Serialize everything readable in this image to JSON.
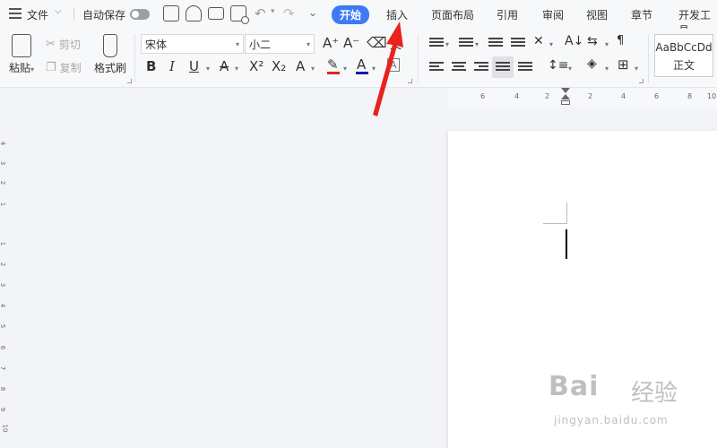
{
  "menubar": {
    "file_label": "文件",
    "autosave_label": "自动保存",
    "tabs": [
      "开始",
      "插入",
      "页面布局",
      "引用",
      "审阅",
      "视图",
      "章节",
      "开发工具"
    ],
    "active_tab": "开始"
  },
  "ribbon": {
    "clipboard": {
      "paste_label": "粘贴",
      "cut_label": "剪切",
      "copy_label": "复制",
      "format_painter_label": "格式刷"
    },
    "font": {
      "font_name": "宋体",
      "font_size": "小二"
    },
    "styles": {
      "preview_text": "AaBbCcDd",
      "style_name": "正文"
    }
  },
  "ruler": {
    "h_numbers": [
      "6",
      "4",
      "2",
      "2",
      "4",
      "6",
      "8",
      "10"
    ],
    "v_numbers": [
      "4",
      "3",
      "2",
      "1",
      "1",
      "2",
      "3",
      "4",
      "5",
      "6",
      "7",
      "8",
      "9",
      "10"
    ]
  },
  "watermark": {
    "brand": "Bai",
    "brand2": "经验",
    "url": "jingyan.baidu.com"
  },
  "colors": {
    "accent": "#3d7bf5",
    "annotation": "#e8231b",
    "highlight": "#e8231b",
    "font_color": "#1a1aa8"
  }
}
